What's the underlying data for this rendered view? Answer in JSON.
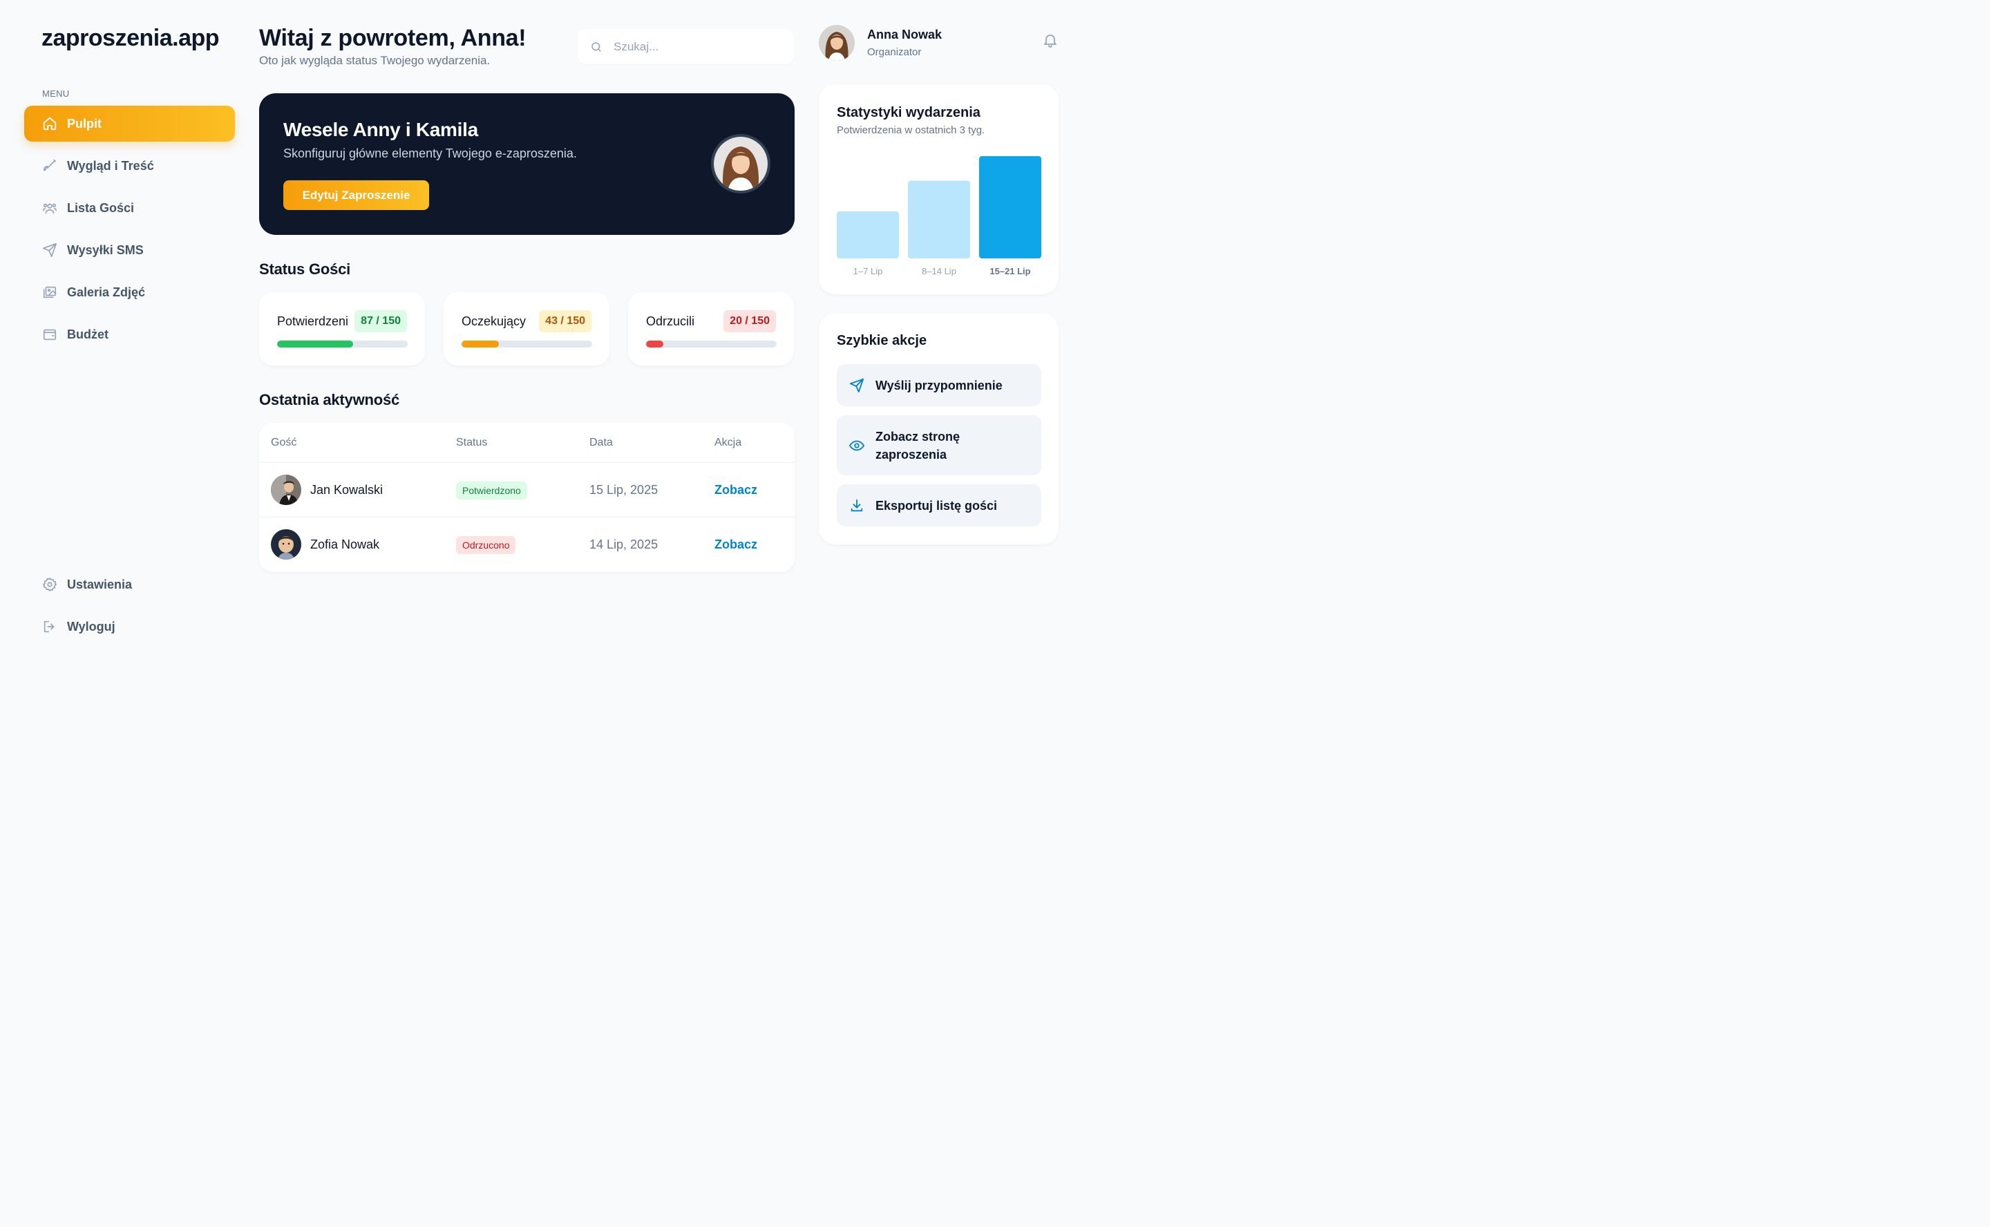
{
  "app": {
    "logo": "zaproszenia.app"
  },
  "sidebar": {
    "menu_label": "MENU",
    "items": [
      {
        "label": "Pulpit",
        "icon": "home-icon",
        "active": true
      },
      {
        "label": "Wygląd i Treść",
        "icon": "brush-icon"
      },
      {
        "label": "Lista Gości",
        "icon": "users-icon"
      },
      {
        "label": "Wysyłki SMS",
        "icon": "send-icon"
      },
      {
        "label": "Galeria Zdjęć",
        "icon": "gallery-icon"
      },
      {
        "label": "Budżet",
        "icon": "wallet-icon"
      }
    ],
    "bottom_items": [
      {
        "label": "Ustawienia",
        "icon": "gear-icon"
      },
      {
        "label": "Wyloguj",
        "icon": "logout-icon"
      }
    ]
  },
  "header": {
    "welcome": "Witaj z powrotem, Anna!",
    "subtitle": "Oto jak wygląda status Twojego wydarzenia.",
    "search_placeholder": "Szukaj...",
    "user": {
      "name": "Anna Nowak",
      "role": "Organizator"
    }
  },
  "hero": {
    "title": "Wesele Anny i Kamila",
    "subtitle": "Skonfiguruj główne elementy Twojego e-zaproszenia.",
    "button": "Edytuj Zaproszenie"
  },
  "guest_status": {
    "title": "Status Gości",
    "cards": [
      {
        "label": "Potwierdzeni",
        "value": "87 / 150",
        "fraction": 0.58,
        "color": "#22c55e",
        "badge_bg": "#dcfce7",
        "badge_fg": "#15803d"
      },
      {
        "label": "Oczekujący",
        "value": "43 / 150",
        "fraction": 0.2867,
        "color": "#f59e0b",
        "badge_bg": "#fef3c7",
        "badge_fg": "#b45309"
      },
      {
        "label": "Odrzucili",
        "value": "20 / 150",
        "fraction": 0.1333,
        "color": "#ef4444",
        "badge_bg": "#fee2e2",
        "badge_fg": "#b91c1c"
      }
    ]
  },
  "activity": {
    "title": "Ostatnia aktywność",
    "columns": [
      "Gość",
      "Status",
      "Data",
      "Akcja"
    ],
    "rows": [
      {
        "name": "Jan Kowalski",
        "status": "Potwierdzono",
        "status_bg": "#dcfce7",
        "status_fg": "#15803d",
        "date": "15 Lip, 2025",
        "action": "Zobacz"
      },
      {
        "name": "Zofia Nowak",
        "status": "Odrzucono",
        "status_bg": "#fee2e2",
        "status_fg": "#b91c1c",
        "date": "14 Lip, 2025",
        "action": "Zobacz"
      }
    ]
  },
  "stats": {
    "title": "Statystyki wydarzenia",
    "subtitle": "Potwierdzenia w ostatnich 3 tyg."
  },
  "chart_data": {
    "type": "bar",
    "categories": [
      "1–7 Lip",
      "8–14 Lip",
      "15–21 Lip"
    ],
    "values": [
      46,
      76,
      100
    ],
    "highlight_index": 2,
    "colors": {
      "normal": "#bae6fd",
      "highlight": "#0ea5e9"
    },
    "title": "Statystyki wydarzenia",
    "subtitle": "Potwierdzenia w ostatnich 3 tyg.",
    "xlabel": "",
    "ylabel": "",
    "ylim": [
      0,
      100
    ],
    "grid": false
  },
  "quick_actions": {
    "title": "Szybkie akcje",
    "items": [
      {
        "label": "Wyślij przypomnienie",
        "icon": "send-icon"
      },
      {
        "label": "Zobacz stronę zaproszenia",
        "icon": "eye-icon"
      },
      {
        "label": "Eksportuj listę gości",
        "icon": "download-icon"
      }
    ]
  },
  "colors": {
    "accent": "#f59e0b",
    "accent_light": "#fbbf24",
    "dark": "#0f172a",
    "link": "#0284c7"
  }
}
